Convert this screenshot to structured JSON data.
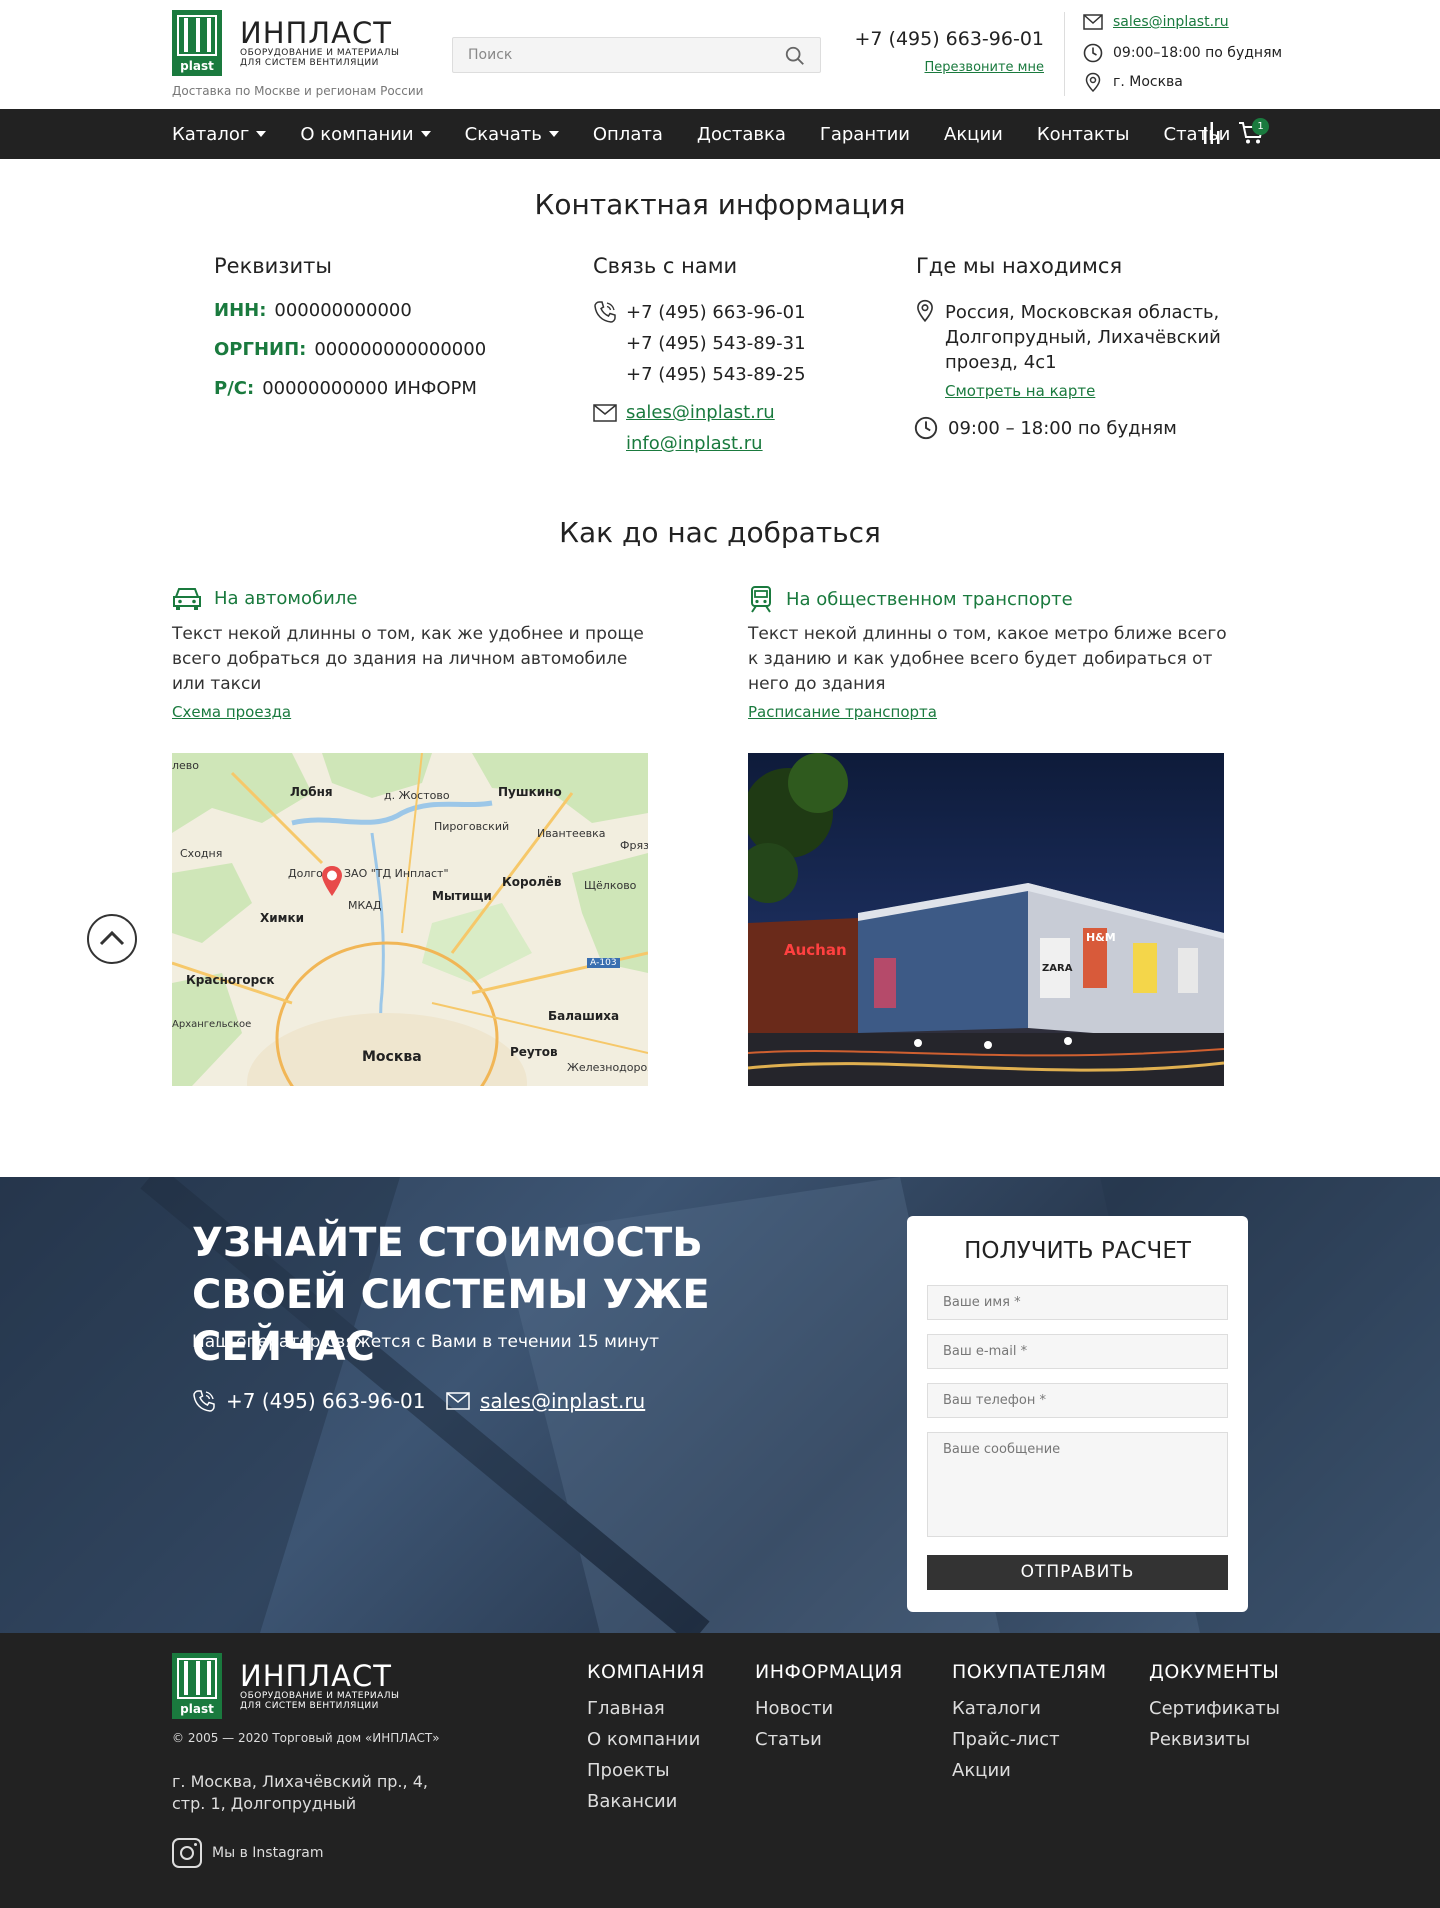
{
  "header": {
    "logo": {
      "name": "ИНПЛАСТ",
      "sub1": "Оборудование и материалы",
      "sub2": "для систем вентиляции",
      "badge": "plast"
    },
    "delivery": "Доставка по Москве и регионам России",
    "search_placeholder": "Поиск",
    "phone": "+7 (495) 663-96-01",
    "callback": "Перезвоните мне",
    "email": "sales@inplast.ru",
    "hours": "09:00–18:00 по будням",
    "city": "г. Москва"
  },
  "nav": {
    "items": [
      {
        "label": "Каталог",
        "dropdown": true
      },
      {
        "label": "О компании",
        "dropdown": true
      },
      {
        "label": "Скачать",
        "dropdown": true
      },
      {
        "label": "Оплата"
      },
      {
        "label": "Доставка"
      },
      {
        "label": "Гарантии"
      },
      {
        "label": "Акции"
      },
      {
        "label": "Контакты"
      },
      {
        "label": "Статьи"
      }
    ],
    "cart_count": "1"
  },
  "contacts": {
    "title": "Контактная информация",
    "requisites": {
      "title": "Реквизиты",
      "inn_label": "ИНН:",
      "inn": "000000000000",
      "ogrnip_label": "ОРГНИП:",
      "ogrnip": "000000000000000",
      "rs_label": "Р/С:",
      "rs": "00000000000 ИНФОРМ"
    },
    "connect": {
      "title": "Связь с нами",
      "phones": [
        "+7 (495) 663-96-01",
        "+7 (495) 543-89-31",
        "+7 (495) 543-89-25"
      ],
      "emails": [
        "sales@inplast.ru",
        "info@inplast.ru"
      ]
    },
    "location": {
      "title": "Где мы находимся",
      "address_l1": "Россия, Московская область,",
      "address_l2": "Долгопрудный, Лихачёвский",
      "address_l3": "проезд, 4с1",
      "map_link": "Смотреть на карте",
      "hours": "09:00 – 18:00 по будням"
    }
  },
  "route": {
    "title": "Как до нас добраться",
    "car": {
      "title": "На автомобиле",
      "text": "Текст некой длинны о том, как же удобнее и проще всего добраться до здания на личном автомобиле или такси",
      "link": "Схема проезда"
    },
    "transit": {
      "title": "На общественном транспорте",
      "text": "Текст некой длинны о том, какое метро ближе всего к зданию и как удобнее всего будет добираться от него до здания",
      "link": "Расписание транспорта"
    },
    "map_labels": {
      "lobnya": "Лобня",
      "zhostovo": "д. Жостово",
      "pushkino": "Пушкино",
      "pirogovsky": "Пироговский",
      "ivanteevka": "Ивантеевка",
      "fryazino": "Фряз",
      "shodnya": "Сходня",
      "dolgo": "Долго",
      "company": "ЗАО \"ТД Инпласт\"",
      "korolev": "Королёв",
      "schelkovo": "Щёлково",
      "khimki": "Химки",
      "mytischi": "Мытищи",
      "krasnogorsk": "Красногорск",
      "a103": "А-103",
      "balashikha": "Балашиха",
      "arkhangelskoe": "Архангельское",
      "reutov": "Реутов",
      "moskva": "Москва",
      "zheleznodor": "Железнодорож",
      "mkad": "МКАД",
      "zeleno": "лево"
    },
    "photo_signs": {
      "auchan": "Auchan",
      "hm": "H&M",
      "zara": "ZARA"
    }
  },
  "cta": {
    "title": "УЗНАЙТЕ СТОИМОСТЬ СВОЕЙ СИСТЕМЫ УЖЕ СЕЙЧАС",
    "subtitle": "Наш оператор свяжется с Вами в течении 15 минут",
    "phone": "+7 (495) 663-96-01",
    "email": "sales@inplast.ru",
    "form": {
      "title": "ПОЛУЧИТЬ РАСЧЕТ",
      "name": "Ваше имя  *",
      "email": "Ваш e-mail  *",
      "phone": "Ваш телефон  *",
      "message": "Ваше сообщение",
      "submit": "ОТПРАВИТЬ"
    }
  },
  "footer": {
    "copyright": "© 2005 — 2020 Торговый дом «ИНПЛАСТ»",
    "address": "г. Москва, Лихачёвский пр., 4, стр. 1, Долгопрудный",
    "instagram": "Мы в Instagram",
    "columns": [
      {
        "title": "КОМПАНИЯ",
        "items": [
          "Главная",
          "О компании",
          "Проекты",
          "Вакансии"
        ]
      },
      {
        "title": "ИНФОРМАЦИЯ",
        "items": [
          "Новости",
          "Статьи"
        ]
      },
      {
        "title": "ПОКУПАТЕЛЯМ",
        "items": [
          "Каталоги",
          "Прайс-лист",
          "Акции"
        ]
      },
      {
        "title": "ДОКУМЕНТЫ",
        "items": [
          "Сертификаты",
          "Реквизиты"
        ]
      }
    ]
  },
  "colors": {
    "brand_green": "#1a7a3e",
    "nav_bg": "#222222",
    "footer_bg": "#222222"
  }
}
